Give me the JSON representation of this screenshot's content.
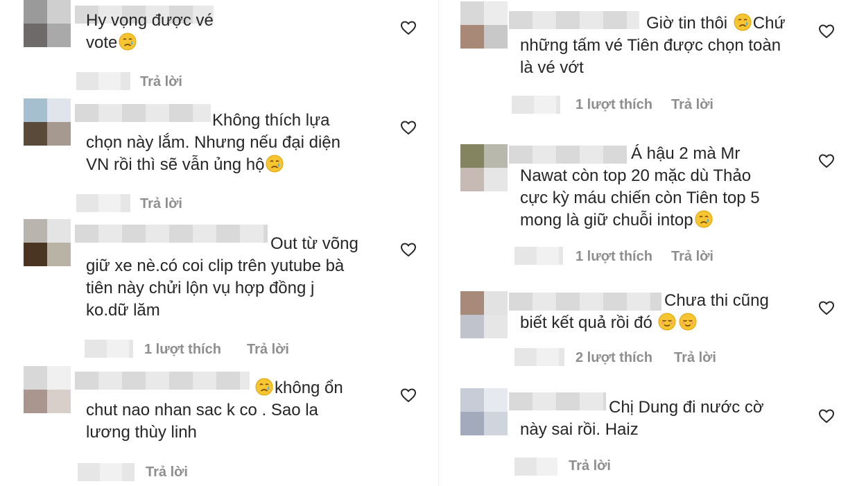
{
  "icons": {
    "like": "heart-outline-icon",
    "crying": "crying-face-emoji",
    "relieved": "relieved-face-emoji"
  },
  "colors": {
    "text": "#262626",
    "meta": "#8e8e8e",
    "blur_light": "#e6e6e6"
  },
  "comments": {
    "c1": {
      "text": "Hy vọng được vé\nvote",
      "reply": "Trả lời"
    },
    "c2": {
      "text": "Không thích lựa\nchọn này lắm. Nhưng nếu đại diện\nVN rồi thì sẽ vẫn ủng hộ",
      "reply": "Trả lời"
    },
    "c3": {
      "text": "Out từ võng\ngiữ xe nè.có coi clip trên yutube bà\ntiên này chửi lộn vụ hợp đồng j\nko.dữ lăm",
      "likes": "1 lượt thích",
      "reply": "Trả lời"
    },
    "c4": {
      "text": "không ổn\nchut nao nhan sac k co . Sao la\nlương thùy linh",
      "reply": "Trả lời"
    },
    "c5": {
      "text_a": "Giờ tin thôi ",
      "text_b": "Chứ\nnhững tấm vé Tiên được chọn toàn\nlà vé vớt",
      "likes": "1 lượt thích",
      "reply": "Trả lời"
    },
    "c6": {
      "text": "Á hậu 2 mà Mr\nNawat còn top 20 mặc dù Thảo\ncực kỳ máu chiến còn Tiên top 5\nmong là giữ chuỗi intop",
      "likes": "1 lượt thích",
      "reply": "Trả lời"
    },
    "c7": {
      "text": "Chưa thi cũng\nbiết kết quả rồi đó ",
      "likes": "2 lượt thích",
      "reply": "Trả lời"
    },
    "c8": {
      "text": "Chị Dung đi nước cờ\nnày sai rồi. Haiz",
      "reply": "Trả lời"
    }
  }
}
